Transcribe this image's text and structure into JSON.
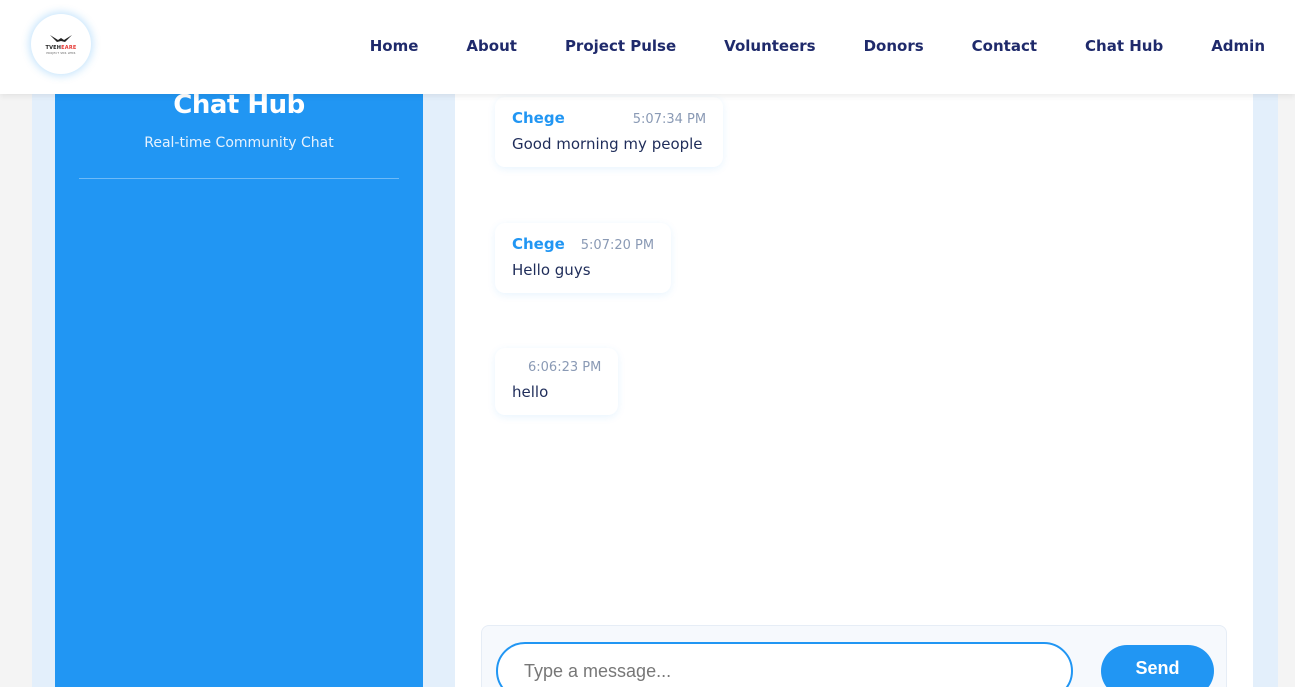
{
  "brand": {
    "logo_word_prefix": "TVEH",
    "logo_word_accent": "EARE",
    "logo_tagline": "PROJECT SMS LEMS",
    "logo_icon": "eagle-icon"
  },
  "nav": {
    "items": [
      {
        "label": "Home"
      },
      {
        "label": "About"
      },
      {
        "label": "Project Pulse"
      },
      {
        "label": "Volunteers"
      },
      {
        "label": "Donors"
      },
      {
        "label": "Contact"
      },
      {
        "label": "Chat Hub"
      },
      {
        "label": "Admin"
      }
    ]
  },
  "sidebar": {
    "title": "Chat Hub",
    "subtitle": "Real-time Community Chat"
  },
  "chat": {
    "messages": [
      {
        "sender": "Chege",
        "time": "5:07:34 PM",
        "text": "Good morning my people"
      },
      {
        "sender": "Chege",
        "time": "5:07:20 PM",
        "text": "Hello guys"
      },
      {
        "sender": "",
        "time": "6:06:23 PM",
        "text": "hello"
      }
    ]
  },
  "composer": {
    "placeholder": "Type a message...",
    "value": "",
    "send_label": "Send"
  },
  "colors": {
    "accent": "#2196f3",
    "nav_text": "#1f2a6b",
    "message_text": "#1f2d5a",
    "timestamp": "#8a9ab5"
  }
}
